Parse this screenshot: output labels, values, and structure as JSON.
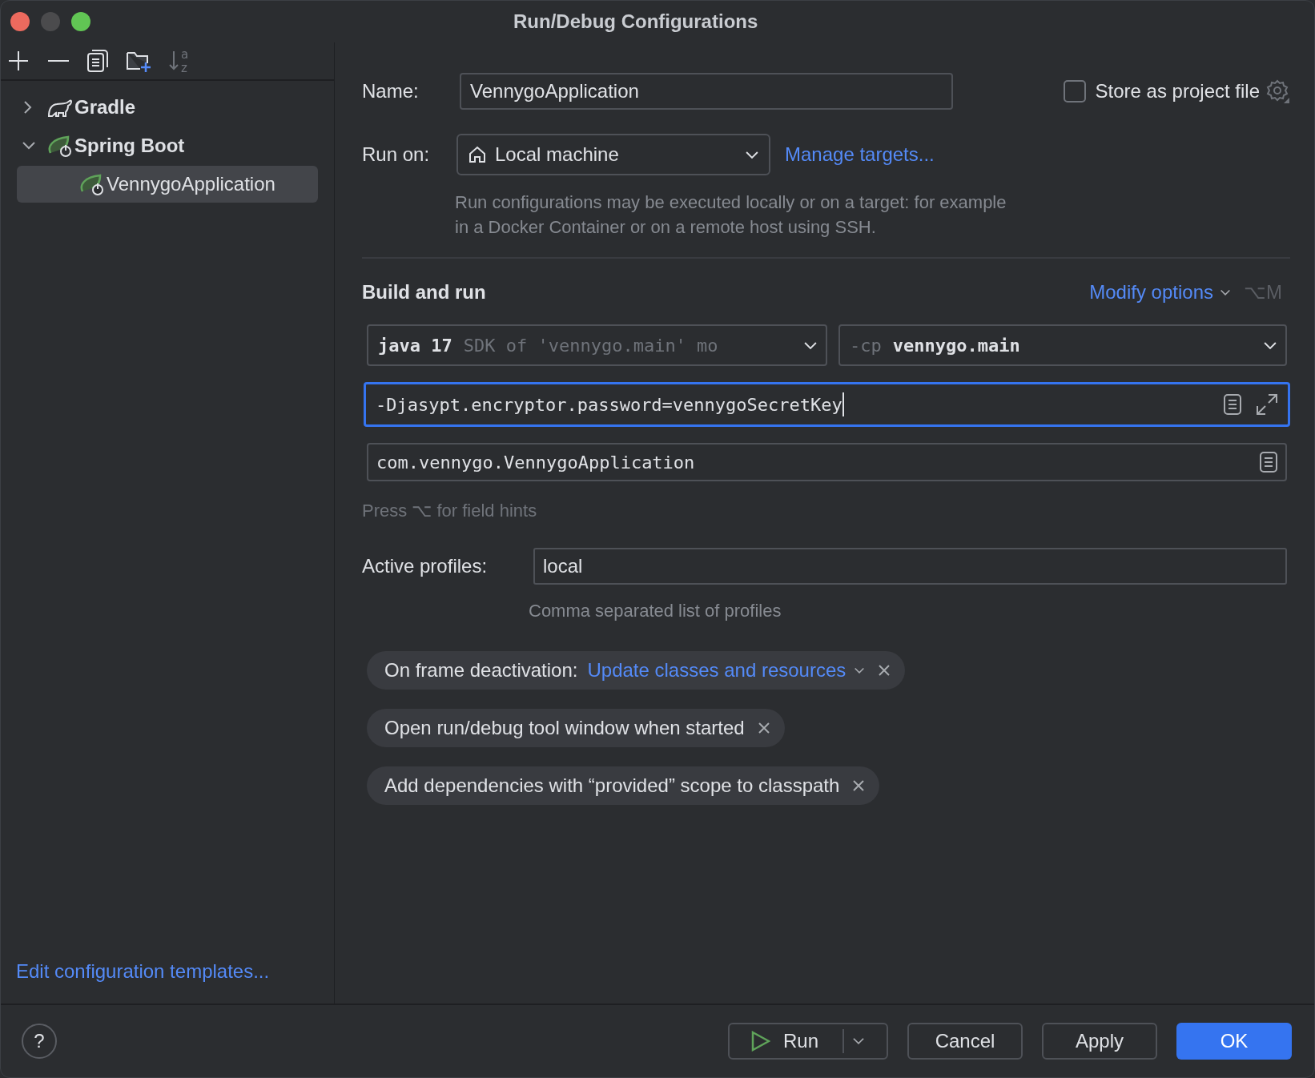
{
  "window": {
    "title": "Run/Debug Configurations"
  },
  "toolbar": {
    "sort_letters": [
      "a",
      "z"
    ]
  },
  "tree": [
    {
      "label": "Gradle",
      "kind": "gradle",
      "expanded": false,
      "selected": false
    },
    {
      "label": "Spring Boot",
      "kind": "spring",
      "expanded": true,
      "selected": false,
      "children": [
        {
          "label": "VennygoApplication",
          "kind": "spring",
          "selected": true
        }
      ]
    }
  ],
  "edit_templates_link": "Edit configuration templates...",
  "name": {
    "label": "Name:",
    "value": "VennygoApplication"
  },
  "store_as_project_file": {
    "label": "Store as project file",
    "checked": false
  },
  "run_on": {
    "label": "Run on:",
    "value": "Local machine",
    "link": "Manage targets...",
    "help": "Run configurations may be executed locally or on a target: for example in a Docker Container or on a remote host using SSH."
  },
  "build_and_run": {
    "title": "Build and run",
    "modify_options": "Modify options",
    "shortcut": "⌥M",
    "jdk": {
      "value": "java 17",
      "hint": "SDK of 'vennygo.main' mo"
    },
    "classpath": {
      "prefix": "-cp",
      "value": "vennygo.main"
    },
    "vm_options": {
      "value": "-Djasypt.encryptor.password=vennygoSecretKey",
      "focused": true
    },
    "main_class": {
      "value": "com.vennygo.VennygoApplication",
      "focused": false
    },
    "hint": "Press ⌥ for field hints"
  },
  "active_profiles": {
    "label": "Active profiles:",
    "value": "local",
    "help": "Comma separated list of profiles"
  },
  "options": [
    {
      "kind": "dropdown",
      "label": "On frame deactivation:",
      "value": "Update classes and resources"
    },
    {
      "kind": "plain",
      "label": "Open run/debug tool window when started"
    },
    {
      "kind": "plain",
      "label": "Add dependencies with “provided” scope to classpath"
    }
  ],
  "footer": {
    "help": "?",
    "buttons": [
      {
        "kind": "split",
        "label": "Run"
      },
      {
        "kind": "normal",
        "label": "Cancel"
      },
      {
        "kind": "normal",
        "label": "Apply"
      },
      {
        "kind": "default",
        "label": "OK"
      }
    ]
  }
}
